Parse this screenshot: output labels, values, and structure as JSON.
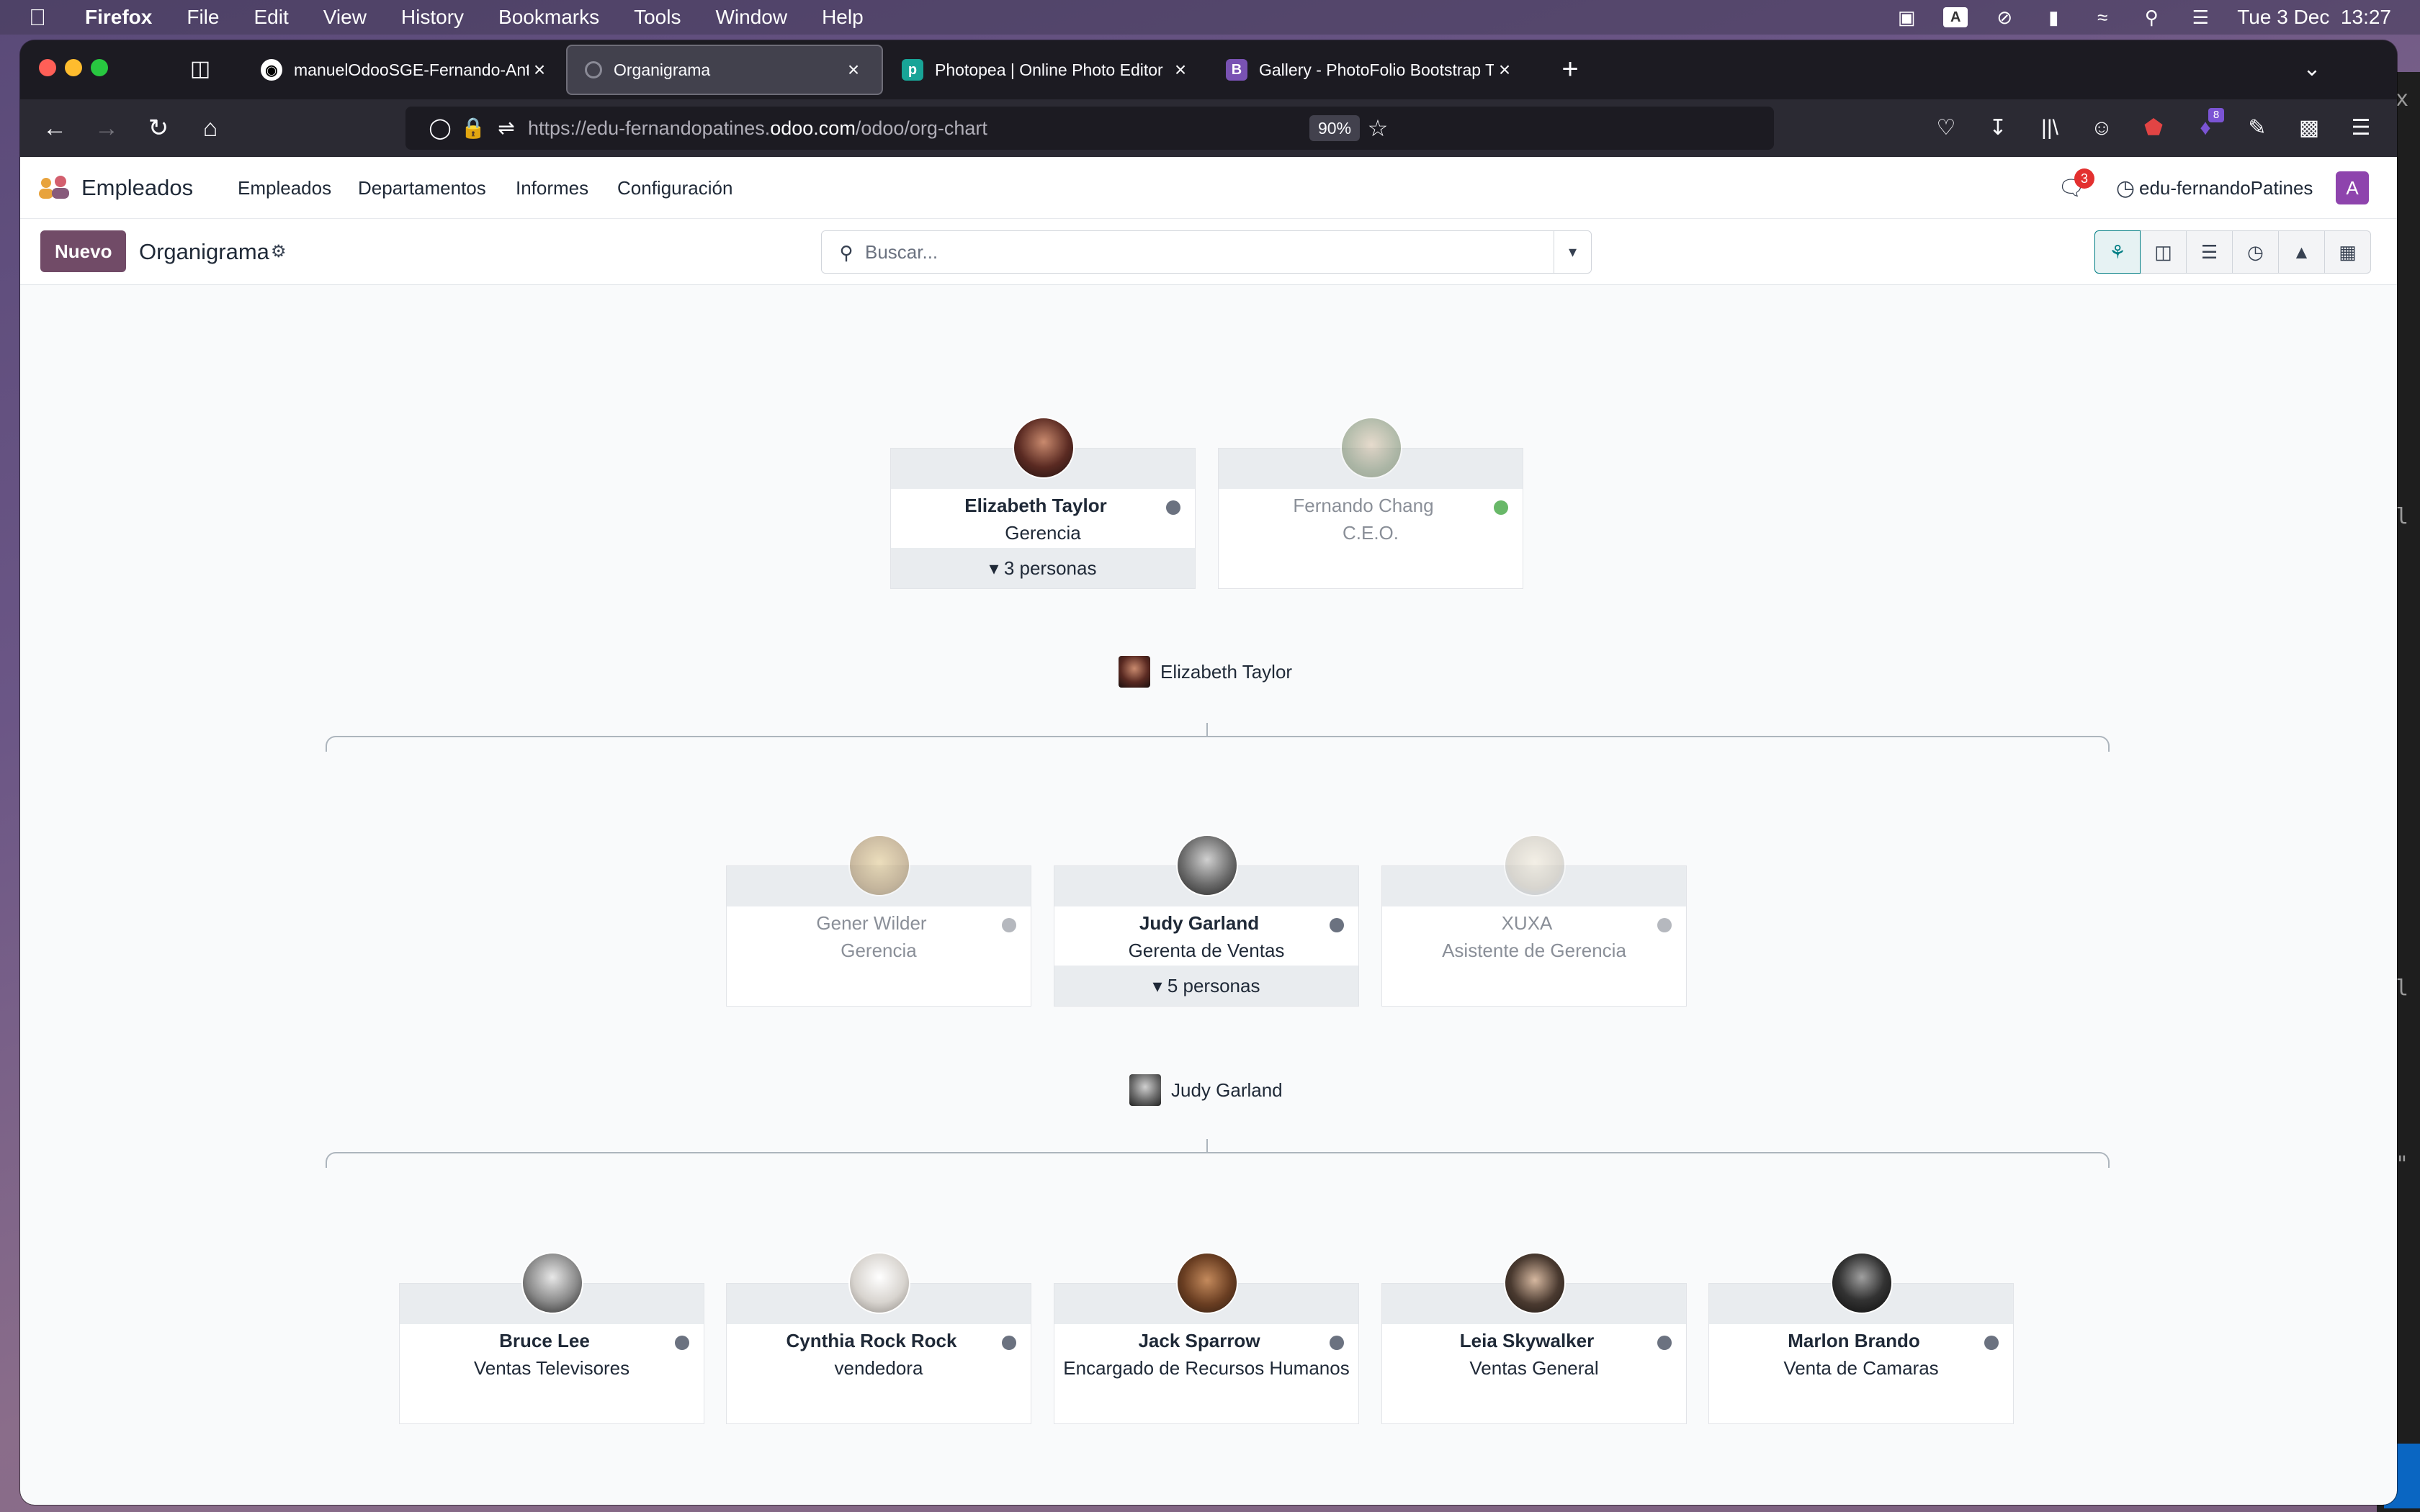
{
  "menubar": {
    "app": "Firefox",
    "items": [
      "File",
      "Edit",
      "View",
      "History",
      "Bookmarks",
      "Tools",
      "Window",
      "Help"
    ],
    "datetime": "Tue 3 Dec  13:27"
  },
  "browser": {
    "tabs": [
      {
        "title": "manuelOdooSGE-Fernando-Ant",
        "favicon": "github-icon"
      },
      {
        "title": "Organigrama",
        "favicon": "odoo-loading-icon"
      },
      {
        "title": "Photopea | Online Photo Editor",
        "favicon": "photopea-icon"
      },
      {
        "title": "Gallery - PhotoFolio Bootstrap T",
        "favicon": "bootstrap-icon"
      }
    ],
    "url_prefix": "https://edu-fernandopatines.",
    "url_host": "odoo.com",
    "url_path": "/odoo/org-chart",
    "zoom": "90%",
    "extensions_badge": "8"
  },
  "odoo": {
    "app_name": "Empleados",
    "menu": [
      "Empleados",
      "Departamentos",
      "Informes",
      "Configuración"
    ],
    "chat_count": "3",
    "db_name": "edu-fernandoPatines",
    "user_initial": "A",
    "new_button": "Nuevo",
    "breadcrumb": "Organigrama",
    "search_placeholder": "Buscar...",
    "views": [
      "hierarchy",
      "kanban",
      "list",
      "activity",
      "graph",
      "pivot"
    ],
    "accent": "#714b67"
  },
  "org": {
    "top": [
      {
        "name": "Elizabeth Taylor",
        "job": "Gerencia",
        "status": "offline",
        "footer": "3 personas"
      },
      {
        "name": "Fernando Chang",
        "job": "C.E.O.",
        "status": "online"
      }
    ],
    "group1_label": "Elizabeth Taylor",
    "level2": [
      {
        "name": "Gener Wilder",
        "job": "Gerencia",
        "status": "away"
      },
      {
        "name": "Judy Garland",
        "job": "Gerenta de Ventas",
        "status": "offline",
        "footer": "5 personas"
      },
      {
        "name": "XUXA",
        "job": "Asistente de Gerencia",
        "status": "away"
      }
    ],
    "group2_label": "Judy Garland",
    "level3": [
      {
        "name": "Bruce Lee",
        "job": "Ventas Televisores",
        "status": "offline"
      },
      {
        "name": "Cynthia Rock Rock",
        "job": "vendedora",
        "status": "offline"
      },
      {
        "name": "Jack Sparrow",
        "job": "Encargado de Recursos Humanos",
        "status": "offline"
      },
      {
        "name": "Leia Skywalker",
        "job": "Ventas General",
        "status": "offline"
      },
      {
        "name": "Marlon Brando",
        "job": "Venta de Camaras",
        "status": "offline"
      }
    ]
  }
}
